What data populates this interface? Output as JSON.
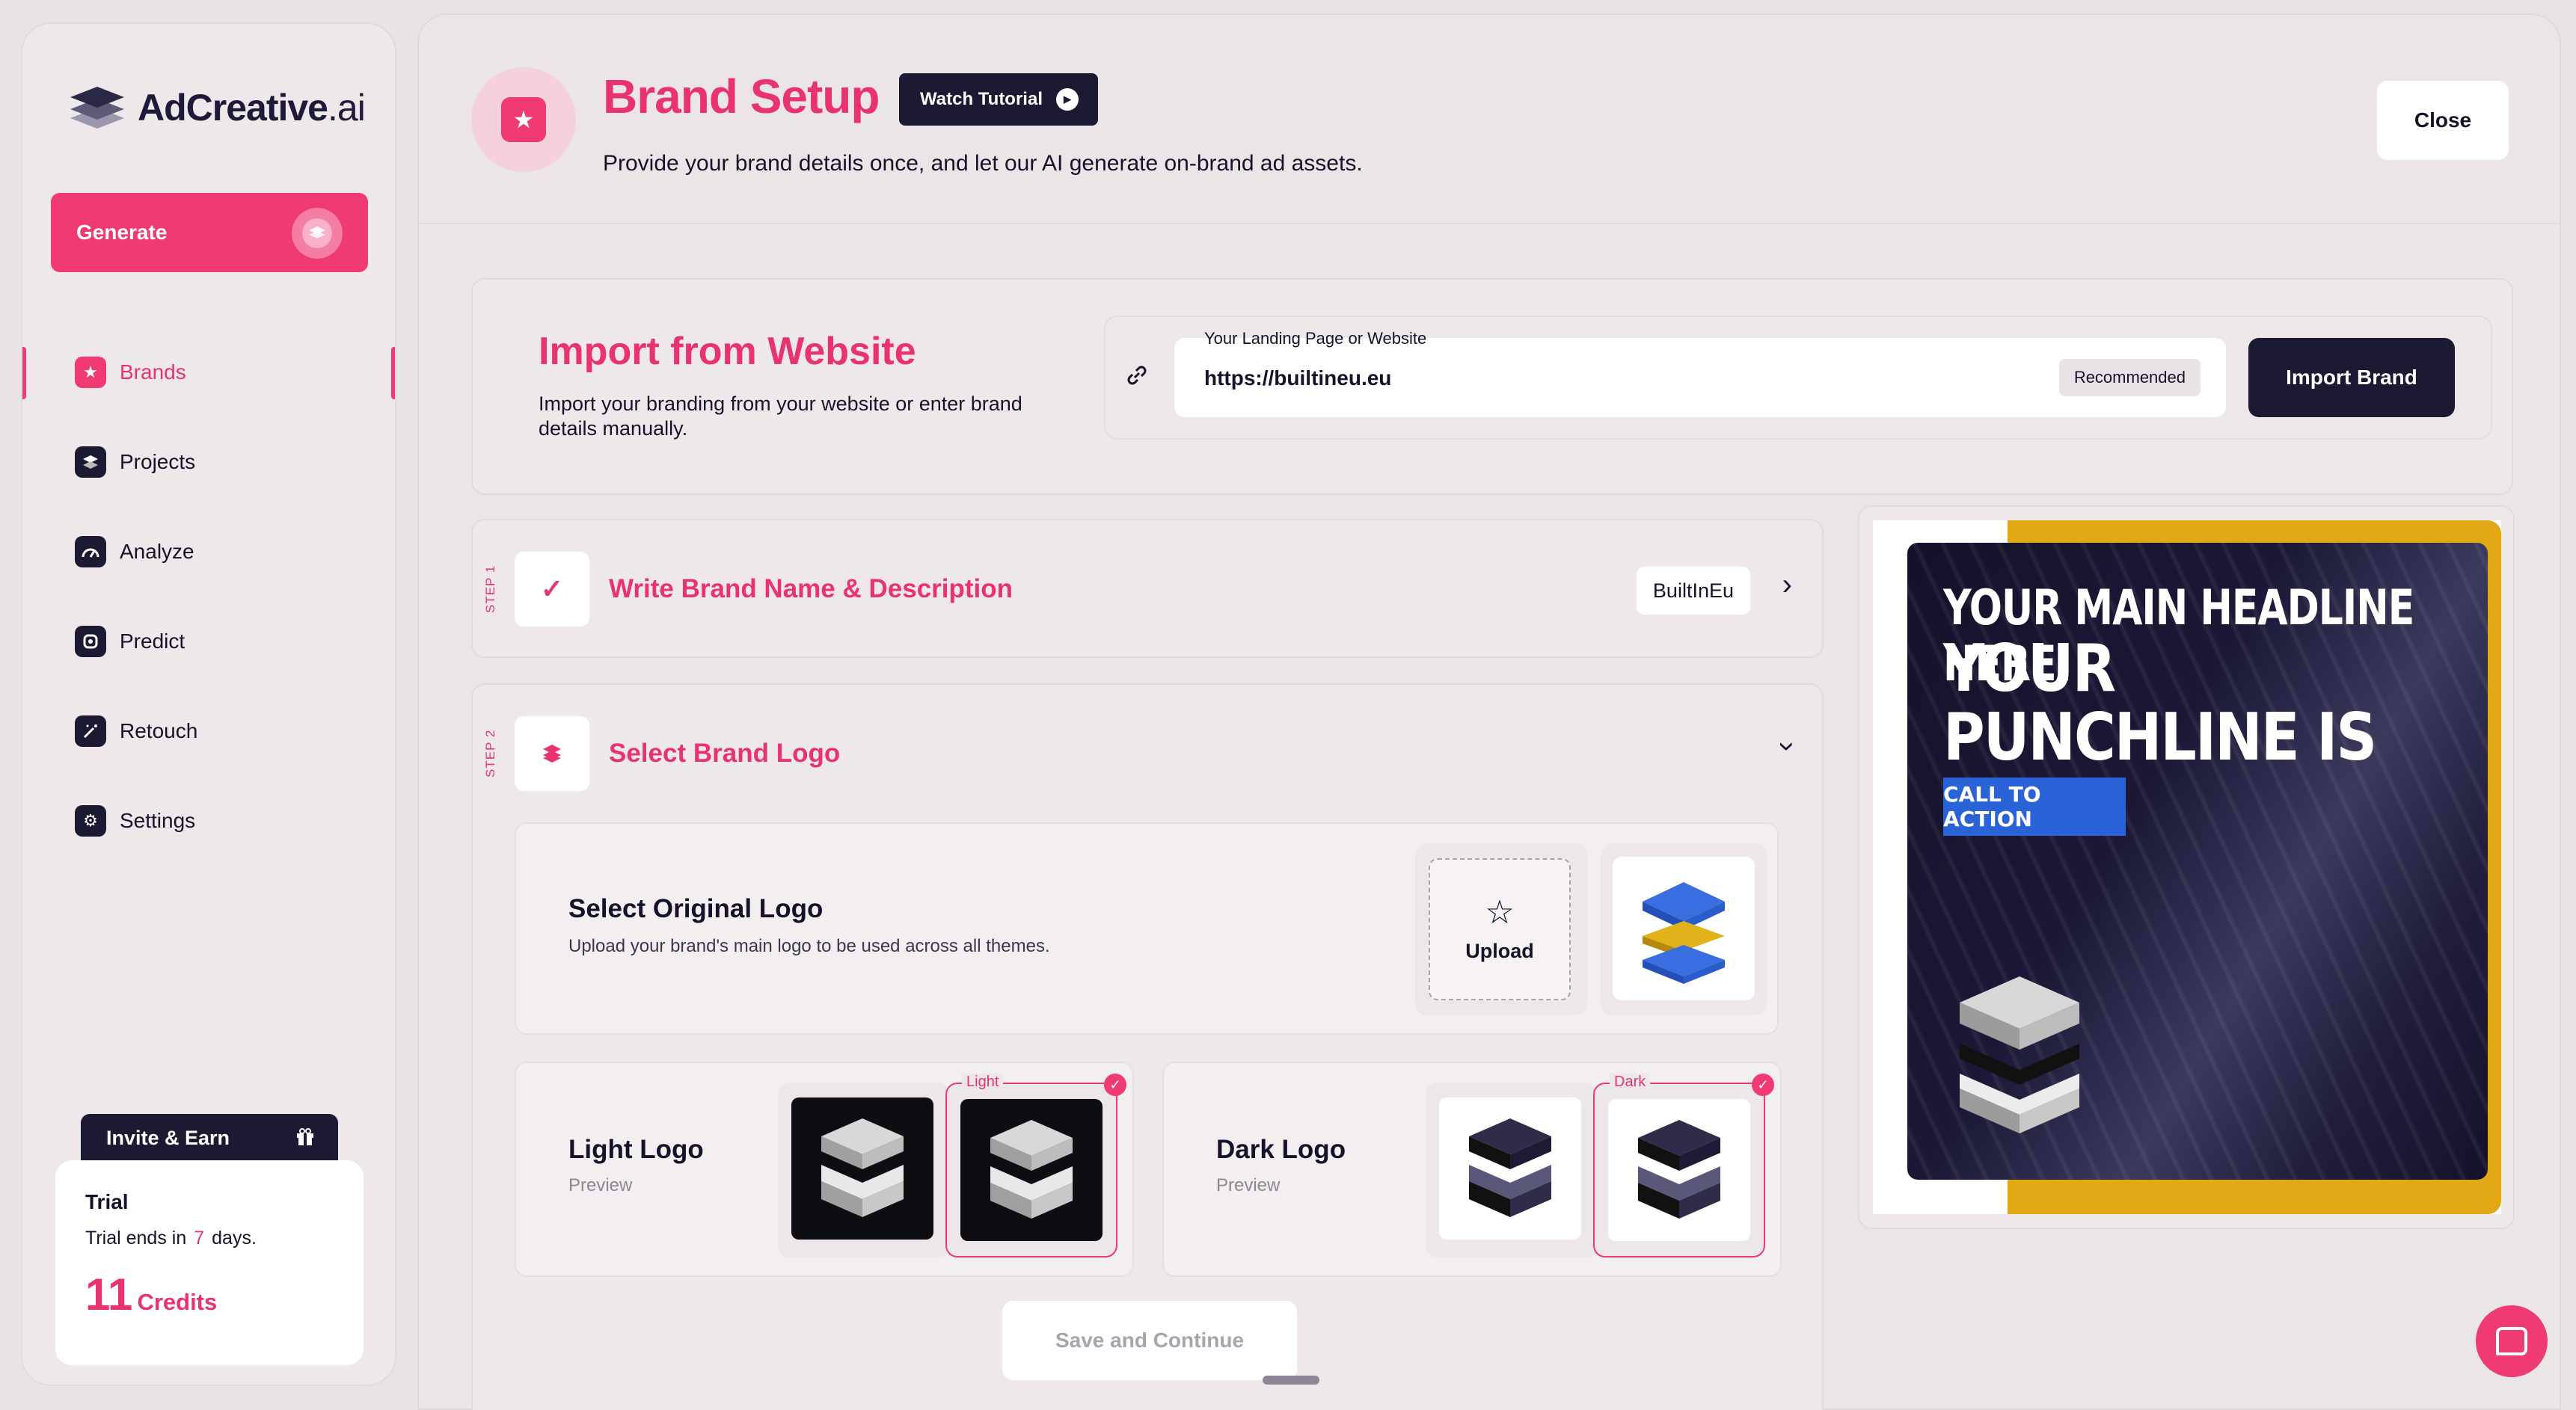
{
  "brand": {
    "name": "AdCreative",
    "suffix": ".ai"
  },
  "sidebar": {
    "generate_label": "Generate",
    "items": [
      {
        "label": "Brands",
        "icon": "star-icon",
        "active": true
      },
      {
        "label": "Projects",
        "icon": "layers-icon"
      },
      {
        "label": "Analyze",
        "icon": "gauge-icon"
      },
      {
        "label": "Predict",
        "icon": "predict-icon"
      },
      {
        "label": "Retouch",
        "icon": "wand-icon"
      },
      {
        "label": "Settings",
        "icon": "gear-icon"
      }
    ],
    "invite_label": "Invite & Earn",
    "trial": {
      "title": "Trial",
      "ends_prefix": "Trial ends in",
      "days": "7",
      "ends_suffix": "days.",
      "credits_count": "11",
      "credits_label": "Credits"
    }
  },
  "header": {
    "title": "Brand Setup",
    "tutorial_label": "Watch Tutorial",
    "subtitle": "Provide your brand details once, and let our AI generate on-brand ad assets.",
    "close_label": "Close"
  },
  "import": {
    "title": "Import from Website",
    "description": "Import your branding from your website or enter brand details manually.",
    "field_label": "Your Landing Page or Website",
    "field_value": "https://builtineu.eu",
    "badge": "Recommended",
    "button_label": "Import Brand"
  },
  "step1": {
    "step_label": "STEP 1",
    "title": "Write Brand Name & Description",
    "brand_chip": "BuiltInEu"
  },
  "step2": {
    "step_label": "STEP 2",
    "title": "Select Brand Logo",
    "original": {
      "title": "Select Original Logo",
      "description": "Upload your brand's main logo to be used across all themes.",
      "upload_label": "Upload"
    },
    "light": {
      "title": "Light Logo",
      "subtitle": "Preview",
      "tag": "Light"
    },
    "dark": {
      "title": "Dark Logo",
      "subtitle": "Preview",
      "tag": "Dark"
    },
    "save_label": "Save and Continue"
  },
  "preview": {
    "headline": "YOUR MAIN HEADLINE HERE!",
    "punchline": "YOUR PUNCHLINE IS HERE!",
    "cta": "CALL TO ACTION"
  },
  "colors": {
    "accent": "#ef3a72",
    "dark": "#1c1a33",
    "gold": "#e2a816",
    "cta_blue": "#2a62d8"
  }
}
